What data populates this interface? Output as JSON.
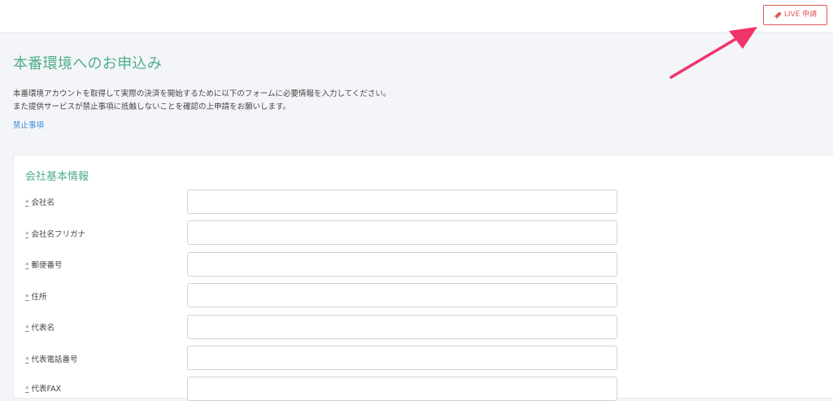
{
  "header": {
    "live_button": {
      "label": "LIVE 申請",
      "icon": "rocket-icon"
    }
  },
  "page": {
    "title": "本番環境へのお申込み",
    "description_line1": "本番環境アカウントを取得して実際の決済を開始するために以下のフォームに必要情報を入力してください。",
    "description_line2": "また提供サービスが禁止事項に抵触しないことを確認の上申請をお願いします。",
    "prohibited_link": "禁止事項"
  },
  "form": {
    "section_title": "会社基本情報",
    "required_mark": "*",
    "fields": [
      {
        "label": "会社名",
        "value": ""
      },
      {
        "label": "会社名フリガナ",
        "value": ""
      },
      {
        "label": "郵便番号",
        "value": ""
      },
      {
        "label": "住所",
        "value": ""
      },
      {
        "label": "代表名",
        "value": ""
      },
      {
        "label": "代表電話番号",
        "value": ""
      },
      {
        "label": "代表FAX",
        "value": ""
      }
    ]
  },
  "colors": {
    "accent_green": "#4fae8d",
    "live_red": "#e15a5a",
    "annotation_arrow": "#f0336b",
    "link_blue": "#3a8fd6"
  }
}
